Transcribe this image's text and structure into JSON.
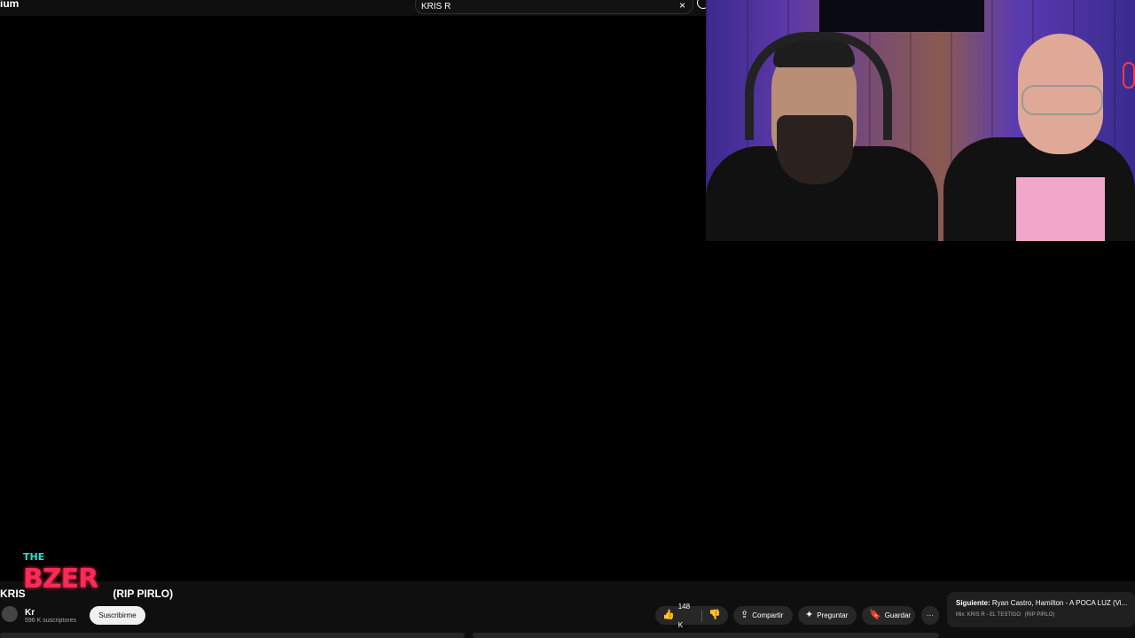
{
  "header": {
    "logo_text": "ium",
    "search_value": "KRIS R",
    "clear_icon": "×"
  },
  "video": {
    "title_left": "KRIS",
    "title_right": "(RIP PIRLO)"
  },
  "overlay": {
    "small": "THE",
    "big": "BZER"
  },
  "channel": {
    "name": "Kr",
    "subscribers": "596 K suscriptores",
    "subscribe_label": "Suscribirme"
  },
  "actions": {
    "like_count": "148 K",
    "share_label": "Compartir",
    "ask_label": "Preguntar",
    "save_label": "Guardar",
    "more_label": "···"
  },
  "next": {
    "prefix": "Siguiente:",
    "title": "Ryan Castro, Hamilton - A POCA LUZ (Vi...",
    "mix": "Mix: KRIS R - EL TESTIGO  (RIP PIRLO)"
  },
  "icons": {
    "like": "thumbs-up-icon",
    "dislike": "thumbs-down-icon",
    "share": "share-icon",
    "ask": "sparkle-icon",
    "save": "bookmark-icon",
    "more": "more-horizontal-icon"
  },
  "colors": {
    "background": "#000000",
    "pill": "#272727",
    "subscribe": "#f1f1f1",
    "overlay_pink": "#ff2a55",
    "overlay_teal": "#28e0c8"
  }
}
